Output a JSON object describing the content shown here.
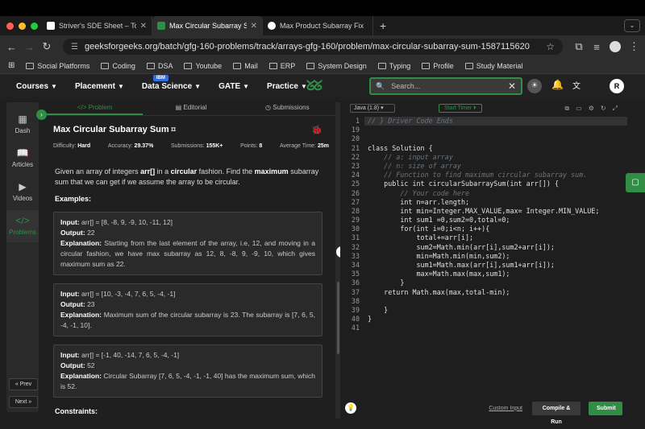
{
  "browser": {
    "tabs": [
      {
        "title": "Striver's SDE Sheet – Top Co",
        "close": "✕"
      },
      {
        "title": "Max Circular Subarray Sum |",
        "close": "✕"
      },
      {
        "title": "Max Product Subarray Fix",
        "close": ""
      }
    ],
    "new_tab": "+",
    "url": "geeksforgeeks.org/batch/gfg-160-problems/track/arrays-gfg-160/problem/max-circular-subarray-sum-1587115620",
    "bookmarks": [
      "Social Platforms",
      "Coding",
      "DSA",
      "Youtube",
      "Mail",
      "ERP",
      "System Design",
      "Typing",
      "Profile",
      "Study Material"
    ]
  },
  "site_nav": {
    "items": [
      "Courses",
      "Placement",
      "Data Science",
      "GATE",
      "Practice"
    ],
    "badge": "IBM",
    "search_placeholder": "Search...",
    "profile_initial": "R"
  },
  "rail": {
    "items": [
      "Dash",
      "Articles",
      "Videos",
      "Problems"
    ],
    "prev": "« Prev",
    "next": "Next »"
  },
  "problem": {
    "tabs": [
      "Problem",
      "Editorial",
      "Submissions"
    ],
    "title": "Max Circular Subarray Sum",
    "difficulty_label": "Difficulty:",
    "difficulty": "Hard",
    "accuracy_label": "Accuracy:",
    "accuracy": "29.37%",
    "submissions_label": "Submissions:",
    "submissions": "155K+",
    "points_label": "Points:",
    "points": "8",
    "avg_time_label": "Average Time:",
    "avg_time": "25m",
    "desc_1": "Given an array of integers ",
    "desc_arr": "arr[]",
    "desc_2": " in a ",
    "desc_circ": "circular",
    "desc_3": " fashion. Find the ",
    "desc_max": "maximum",
    "desc_4": " subarray sum that we can get if we assume the array to be circular.",
    "examples_heading": "Examples:",
    "examples": [
      {
        "input": "arr[] = [8, -8, 9, -9, 10, -11, 12]",
        "output": "22",
        "explanation": "Starting from the last element of the array, i.e, 12, and moving in a circular fashion, we have max subarray as 12, 8, -8, 9, -9, 10, which gives maximum sum as 22."
      },
      {
        "input": "arr[] = [10, -3, -4, 7, 6, 5, -4, -1]",
        "output": "23",
        "explanation": "Maximum sum of the circular subarray is 23. The subarray is [7, 6, 5, -4, -1, 10]."
      },
      {
        "input": "arr[] = [-1, 40, -14, 7, 6, 5, -4, -1]",
        "output": "52",
        "explanation": "Circular Subarray [7, 6, 5, -4, -1, -1, 40] has the maximum sum, which is 52."
      }
    ],
    "input_label": "Input:",
    "output_label": "Output:",
    "explanation_label": "Explanation:",
    "constraints_heading": "Constraints:"
  },
  "editor": {
    "language": "Java (1.8)",
    "timer": "Start Timer",
    "custom_input": "Custom Input",
    "compile": "Compile & Run",
    "submit": "Submit",
    "lines": [
      {
        "n": "1",
        "text": "// } Driver Code Ends"
      },
      {
        "n": "19",
        "text": ""
      },
      {
        "n": "20",
        "text": ""
      },
      {
        "n": "21",
        "text": "class Solution {"
      },
      {
        "n": "22",
        "text": "    // a: input array"
      },
      {
        "n": "23",
        "text": "    // n: size of array"
      },
      {
        "n": "24",
        "text": "    // Function to find maximum circular subarray sum."
      },
      {
        "n": "25",
        "text": "    public int circularSubarraySum(int arr[]) {"
      },
      {
        "n": "26",
        "text": "        // Your code here"
      },
      {
        "n": "27",
        "text": "        int n=arr.length;"
      },
      {
        "n": "28",
        "text": "        int min=Integer.MAX_VALUE,max= Integer.MIN_VALUE;"
      },
      {
        "n": "29",
        "text": "        int sum1 =0,sum2=0,total=0;"
      },
      {
        "n": "30",
        "text": "        for(int i=0;i<n; i++){"
      },
      {
        "n": "31",
        "text": "            total+=arr[i];"
      },
      {
        "n": "32",
        "text": "            sum2=Math.min(arr[i],sum2+arr[i]);"
      },
      {
        "n": "33",
        "text": "            min=Math.min(min,sum2);"
      },
      {
        "n": "34",
        "text": "            sum1=Math.max(arr[i],sum1+arr[i]);"
      },
      {
        "n": "35",
        "text": "            max=Math.max(max,sum1);"
      },
      {
        "n": "36",
        "text": "        }"
      },
      {
        "n": "37",
        "text": "    return Math.max(max,total-min);"
      },
      {
        "n": "38",
        "text": ""
      },
      {
        "n": "39",
        "text": "    }"
      },
      {
        "n": "40",
        "text": "}"
      },
      {
        "n": "41",
        "text": ""
      }
    ]
  },
  "colors": {
    "accent": "#2f8d46",
    "background": "#1f1f1f"
  }
}
